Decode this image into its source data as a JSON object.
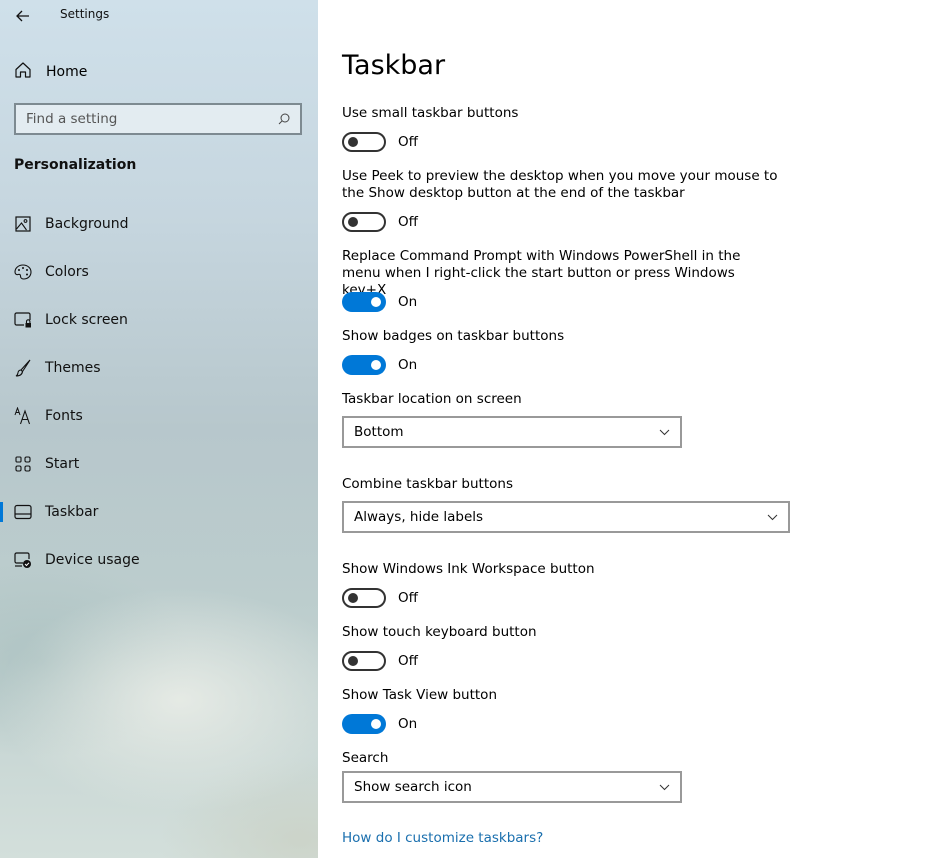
{
  "window": {
    "app_title": "Settings",
    "back_icon": "arrow-left-icon"
  },
  "sidebar": {
    "home_label": "Home",
    "home_icon": "home-icon",
    "search": {
      "placeholder": "Find a setting",
      "value": "",
      "icon": "search-icon"
    },
    "section_heading": "Personalization",
    "items": [
      {
        "label": "Background",
        "icon": "picture-icon",
        "active": false
      },
      {
        "label": "Colors",
        "icon": "palette-icon",
        "active": false
      },
      {
        "label": "Lock screen",
        "icon": "lock-screen-icon",
        "active": false
      },
      {
        "label": "Themes",
        "icon": "brush-icon",
        "active": false
      },
      {
        "label": "Fonts",
        "icon": "font-icon",
        "active": false
      },
      {
        "label": "Start",
        "icon": "start-grid-icon",
        "active": false
      },
      {
        "label": "Taskbar",
        "icon": "taskbar-icon",
        "active": true
      },
      {
        "label": "Device usage",
        "icon": "device-usage-icon",
        "active": false
      }
    ],
    "accent_color": "#0078d7"
  },
  "main": {
    "title": "Taskbar",
    "settings": [
      {
        "label": "Use small taskbar buttons",
        "type": "toggle",
        "state": "Off"
      },
      {
        "label": "Use Peek to preview the desktop when you move your mouse to the Show desktop button at the end of the taskbar",
        "type": "toggle",
        "state": "Off"
      },
      {
        "label": "Replace Command Prompt with Windows PowerShell in the menu when I right-click the start button or press Windows key+X",
        "type": "toggle",
        "state": "On"
      },
      {
        "label": "Show badges on taskbar buttons",
        "type": "toggle",
        "state": "On"
      },
      {
        "label": "Taskbar location on screen",
        "type": "dropdown",
        "value": "Bottom"
      },
      {
        "label": "Combine taskbar buttons",
        "type": "dropdown",
        "value": "Always, hide labels"
      },
      {
        "label": "Show Windows Ink Workspace button",
        "type": "toggle",
        "state": "Off"
      },
      {
        "label": "Show touch keyboard button",
        "type": "toggle",
        "state": "Off"
      },
      {
        "label": "Show Task View button",
        "type": "toggle",
        "state": "On"
      },
      {
        "label": "Search",
        "type": "dropdown",
        "value": "Show search icon"
      }
    ],
    "help_link": "How do I customize taskbars?",
    "toggle_on_color": "#0078d7",
    "link_color": "#1a6fae"
  }
}
